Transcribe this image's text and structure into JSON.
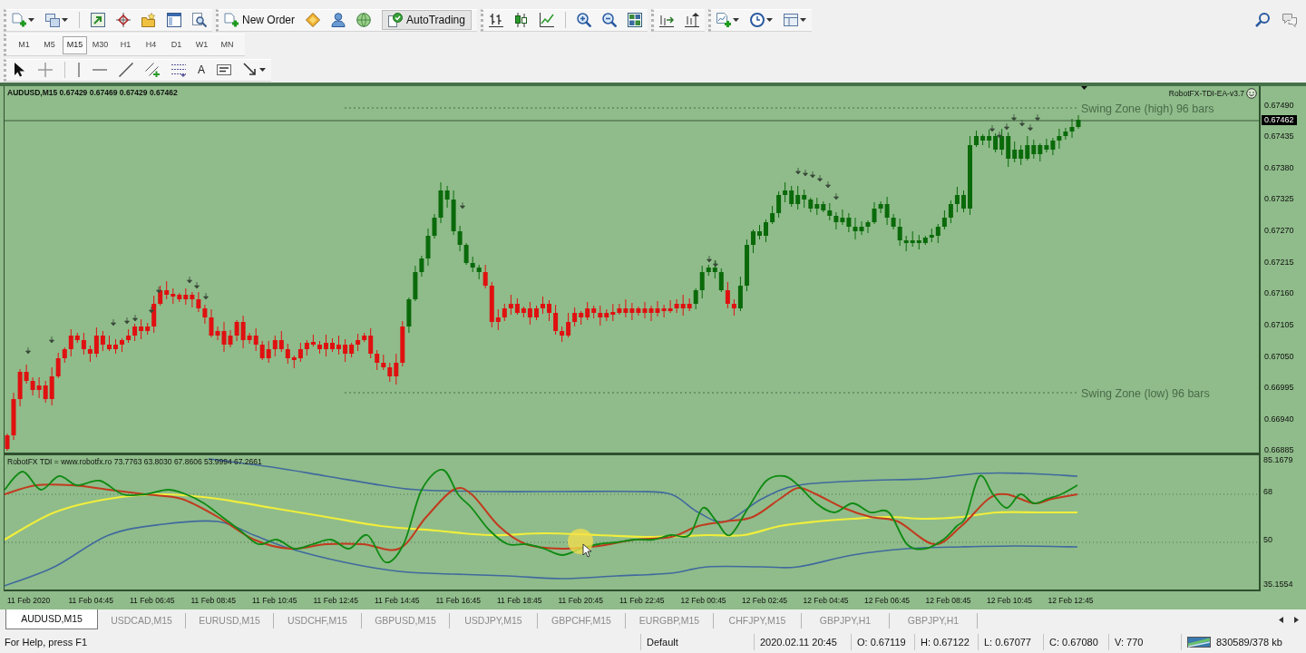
{
  "toolbar": {
    "new_order": "New Order",
    "auto_trading": "AutoTrading"
  },
  "timeframes": [
    {
      "label": "M1",
      "selected": false
    },
    {
      "label": "M5",
      "selected": false
    },
    {
      "label": "M15",
      "selected": true
    },
    {
      "label": "M30",
      "selected": false
    },
    {
      "label": "H1",
      "selected": false
    },
    {
      "label": "H4",
      "selected": false
    },
    {
      "label": "D1",
      "selected": false
    },
    {
      "label": "W1",
      "selected": false
    },
    {
      "label": "MN",
      "selected": false
    }
  ],
  "drawing_toolbar": {
    "text_tool": "A"
  },
  "chart": {
    "header": "AUDUSD,M15 0.67429 0.67469 0.67429 0.67462",
    "expert": "RobotFX-TDI-EA-v3.7",
    "swing_high": "Swing Zone (high) 96 bars",
    "swing_low": "Swing Zone (low) 96 bars",
    "current_price": "0.67462",
    "price_axis": [
      "0.67490",
      "0.67435",
      "0.67380",
      "0.67325",
      "0.67270",
      "0.67215",
      "0.67160",
      "0.67105",
      "0.67050",
      "0.66995",
      "0.66940",
      "0.66885"
    ]
  },
  "indicator": {
    "header": "RobotFX TDI = www.robotfx.ro 73.7763 63.8030 67.8606 53.9994 67.2661",
    "axis": [
      "85.1679",
      "68",
      "50",
      "35.1554"
    ]
  },
  "time_axis": [
    "11 Feb 2020",
    "11 Feb 04:45",
    "11 Feb 06:45",
    "11 Feb 08:45",
    "11 Feb 10:45",
    "11 Feb 12:45",
    "11 Feb 14:45",
    "11 Feb 16:45",
    "11 Feb 18:45",
    "11 Feb 20:45",
    "11 Feb 22:45",
    "12 Feb 00:45",
    "12 Feb 02:45",
    "12 Feb 04:45",
    "12 Feb 06:45",
    "12 Feb 08:45",
    "12 Feb 10:45",
    "12 Feb 12:45"
  ],
  "tabs": [
    {
      "label": "AUDUSD,M15",
      "selected": true
    },
    {
      "label": "USDCAD,M15",
      "selected": false
    },
    {
      "label": "EURUSD,M15",
      "selected": false
    },
    {
      "label": "USDCHF,M15",
      "selected": false
    },
    {
      "label": "GBPUSD,M15",
      "selected": false
    },
    {
      "label": "USDJPY,M15",
      "selected": false
    },
    {
      "label": "GBPCHF,M15",
      "selected": false
    },
    {
      "label": "EURGBP,M15",
      "selected": false
    },
    {
      "label": "CHFJPY,M15",
      "selected": false
    },
    {
      "label": "GBPJPY,H1",
      "selected": false
    },
    {
      "label": "GBPJPY,H1",
      "selected": false
    }
  ],
  "status_bar": {
    "help": "For Help, press F1",
    "profile": "Default",
    "time": "2020.02.11 20:45",
    "open": "O: 0.67119",
    "high": "H: 0.67122",
    "low": "L: 0.67077",
    "close": "C: 0.67080",
    "volume": "V: 770",
    "traffic": "830589/378 kb"
  }
}
